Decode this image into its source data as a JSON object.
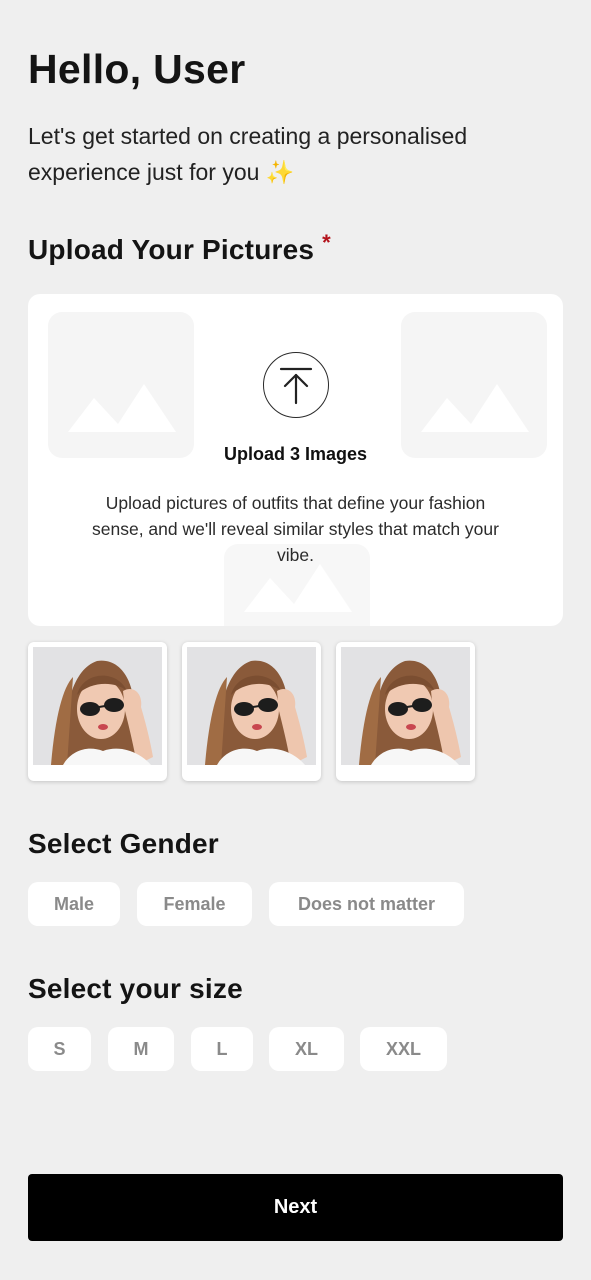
{
  "header": {
    "greeting": "Hello, User",
    "subtitle": "Let's get started on creating a personalised experience just for you ✨"
  },
  "upload": {
    "section_title": "Upload Your Pictures",
    "required_mark": "*",
    "title": "Upload 3 Images",
    "description": "Upload pictures of outfits that define your fashion sense, and we'll reveal similar styles that match your vibe.",
    "upload_icon": "upload-arrow-icon",
    "placeholder_icon": "image-placeholder-icon",
    "thumbnails": [
      {
        "icon": "woman-sunglasses-photo"
      },
      {
        "icon": "woman-sunglasses-photo"
      },
      {
        "icon": "woman-sunglasses-photo"
      }
    ]
  },
  "gender": {
    "section_title": "Select Gender",
    "options": [
      "Male",
      "Female",
      "Does not matter"
    ]
  },
  "size": {
    "section_title": "Select your size",
    "options": [
      "S",
      "M",
      "L",
      "XL",
      "XXL"
    ]
  },
  "footer": {
    "next_label": "Next"
  },
  "colors": {
    "background": "#efefef",
    "card": "#ffffff",
    "primary_button": "#000000",
    "required": "#b3121b",
    "chip_text": "#8a8a8a"
  }
}
